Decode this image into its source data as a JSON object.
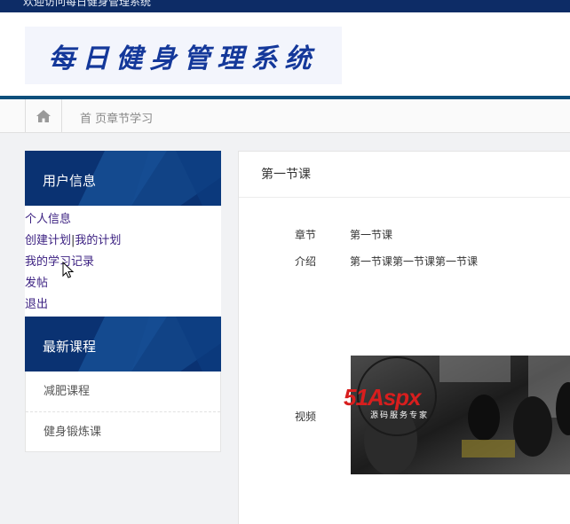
{
  "topbar": {
    "welcome_text": "欢迎访问每日健身管理系统"
  },
  "header": {
    "logo_text": "每日健身管理系统"
  },
  "breadcrumb": {
    "home_label": "首",
    "current_label": "页章节学习"
  },
  "sidebar": {
    "user_panel_title": "用户信息",
    "links": {
      "profile": "个人信息",
      "create_plan": "创建计划",
      "separator": "|",
      "my_plans": "我的计划",
      "study_records": "我的学习记录",
      "post": "发帖",
      "logout": "退出"
    },
    "course_panel_title": "最新课程",
    "courses": [
      "减肥课程",
      "健身锻炼课"
    ]
  },
  "content": {
    "title": "第一节课",
    "chapter_label": "章节",
    "chapter_value": "第一节课",
    "intro_label": "介绍",
    "intro_value": "第一节课第一节课第一节课",
    "video_label": "视频",
    "watermark_brand": "51Aspx",
    "watermark_sub": "源码服务专家"
  },
  "colors": {
    "topbar": "#0d2c66",
    "panel_header": "#0a3272",
    "accent_line": "#0d4f7b",
    "link": "#3a1f80",
    "logo_text": "#14389a"
  }
}
